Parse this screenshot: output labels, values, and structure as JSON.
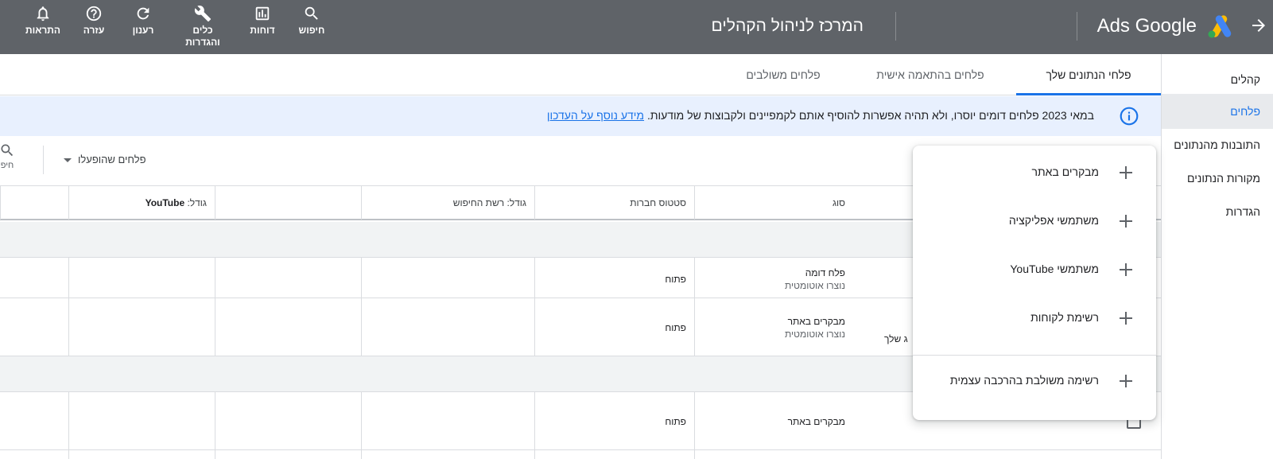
{
  "topbar": {
    "items": [
      {
        "label": "חיפוש",
        "icon": "search-icon"
      },
      {
        "label": "דוחות",
        "icon": "reports-icon"
      },
      {
        "label": "כלים והגדרות",
        "icon": "wrench-icon"
      },
      {
        "label": "רענון",
        "icon": "refresh-icon"
      },
      {
        "label": "עזרה",
        "icon": "help-icon"
      },
      {
        "label": "התראות",
        "icon": "bell-icon"
      }
    ],
    "tools_line1": "כלים",
    "tools_line2": "והגדרות",
    "title": "המרכז לניהול הקהלים",
    "brand": "Google Ads",
    "brand_display": "Ads Google",
    "back_icon": "arrow-icon"
  },
  "sidebar": {
    "items": [
      {
        "label": "קהלים",
        "active": false
      },
      {
        "label": "פלחים",
        "active": true
      },
      {
        "label": "התובנות מהנתונים",
        "active": false
      },
      {
        "label": "מקורות הנתונים",
        "active": false
      },
      {
        "label": "הגדרות",
        "active": false
      }
    ]
  },
  "tabs": [
    {
      "label": "פלחי הנתונים שלך",
      "active": true
    },
    {
      "label": "פלחים בהתאמה אישית",
      "active": false
    },
    {
      "label": "פלחים משולבים",
      "active": false
    }
  ],
  "notice": {
    "icon": "info-icon",
    "text": "במאי 2023 פלחים דומים יוסרו, ולא תהיה אפשרות להוסיף אותם לקמפיינים ולקבוצות של מודעות.",
    "link": "מידע נוסף על העדכון"
  },
  "filters": {
    "dropdown": "פלחים שהופעלו",
    "search_label": "חיפ"
  },
  "table": {
    "headers": {
      "type": "סוג",
      "membership": "סטטוס חברות",
      "size_search": "גודל: רשת החיפוש",
      "size_youtube_prefix": "גודל: ",
      "size_youtube_bold": "YouTube"
    },
    "rows": [
      {
        "type_l1": "פלח דומה",
        "type_l2": "נוצרו אוטומטית",
        "status": "פתוח"
      },
      {
        "type_l1": "מבקרים באתר",
        "type_l2": "נוצרו אוטומטית",
        "status": "פתוח",
        "name_partial": "ג שלך"
      },
      {
        "type_l1": "מבקרים באתר",
        "type_l2": "",
        "status": "פתוח"
      }
    ]
  },
  "menu": {
    "items": [
      {
        "label": "מבקרים באתר"
      },
      {
        "label": "משתמשי אפליקציה"
      },
      {
        "label": "משתמשי YouTube"
      },
      {
        "label": "רשימת לקוחות"
      },
      {
        "label": "רשימה משולבת בהרכבה עצמית"
      }
    ]
  },
  "colors": {
    "topbar": "#5f6368",
    "accent": "#1a73e8",
    "notice_bg": "#e8f0fe"
  }
}
